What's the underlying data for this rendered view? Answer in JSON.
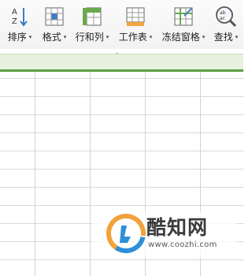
{
  "toolbar": {
    "buttons": [
      {
        "label": "排序",
        "icon": "sort-az-icon"
      },
      {
        "label": "格式",
        "icon": "format-icon"
      },
      {
        "label": "行和列",
        "icon": "rows-columns-icon"
      },
      {
        "label": "工作表",
        "icon": "worksheet-icon"
      },
      {
        "label": "冻结窗格",
        "icon": "freeze-panes-icon"
      },
      {
        "label": "查找",
        "icon": "find-icon"
      }
    ],
    "caret": "▾",
    "collapse_mark": "▴"
  },
  "colors": {
    "green_band": "#e7f1e0",
    "green_line": "#5f9e44",
    "grid_line": "#d9d9d9"
  },
  "watermark": {
    "name": "酷知网",
    "url": "www.coozhi.com",
    "icon": "coozhi-logo-icon"
  }
}
